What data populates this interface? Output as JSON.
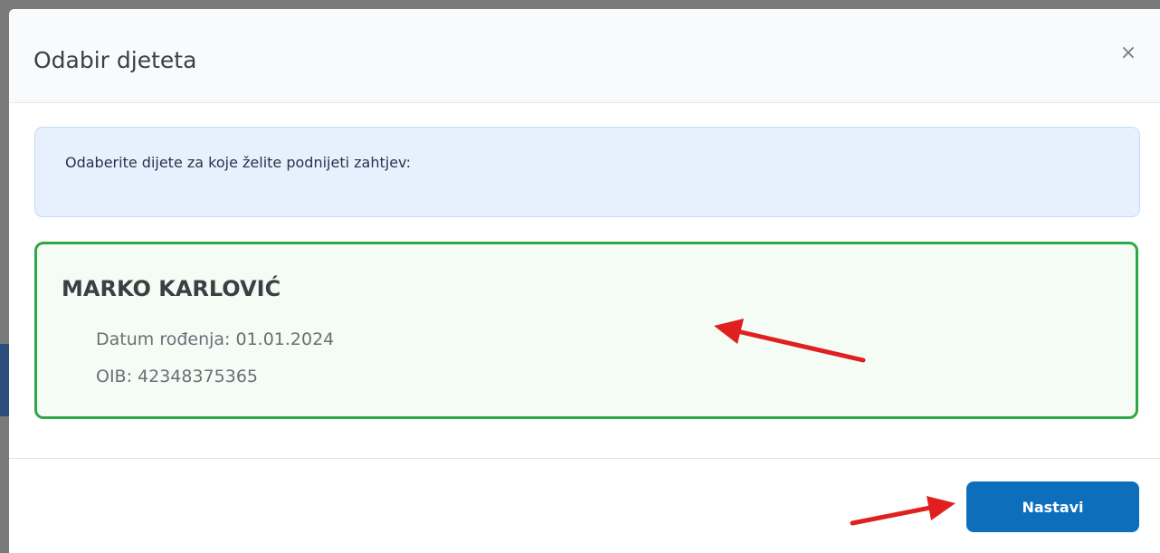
{
  "modal": {
    "title": "Odabir djeteta",
    "close_label": "×",
    "instruction": "Odaberite dijete za koje želite podnijeti zahtjev:"
  },
  "child": {
    "name": "MARKO KARLOVIĆ",
    "dob_text": "Datum rođenja: 01.01.2024",
    "oib_text": "OIB: 42348375365"
  },
  "footer": {
    "continue_label": "Nastavi"
  },
  "colors": {
    "selected_border": "#2ea845",
    "primary_button": "#0d6ebc",
    "info_background": "#e7f1fd",
    "annotation_arrow": "#e0201f"
  }
}
